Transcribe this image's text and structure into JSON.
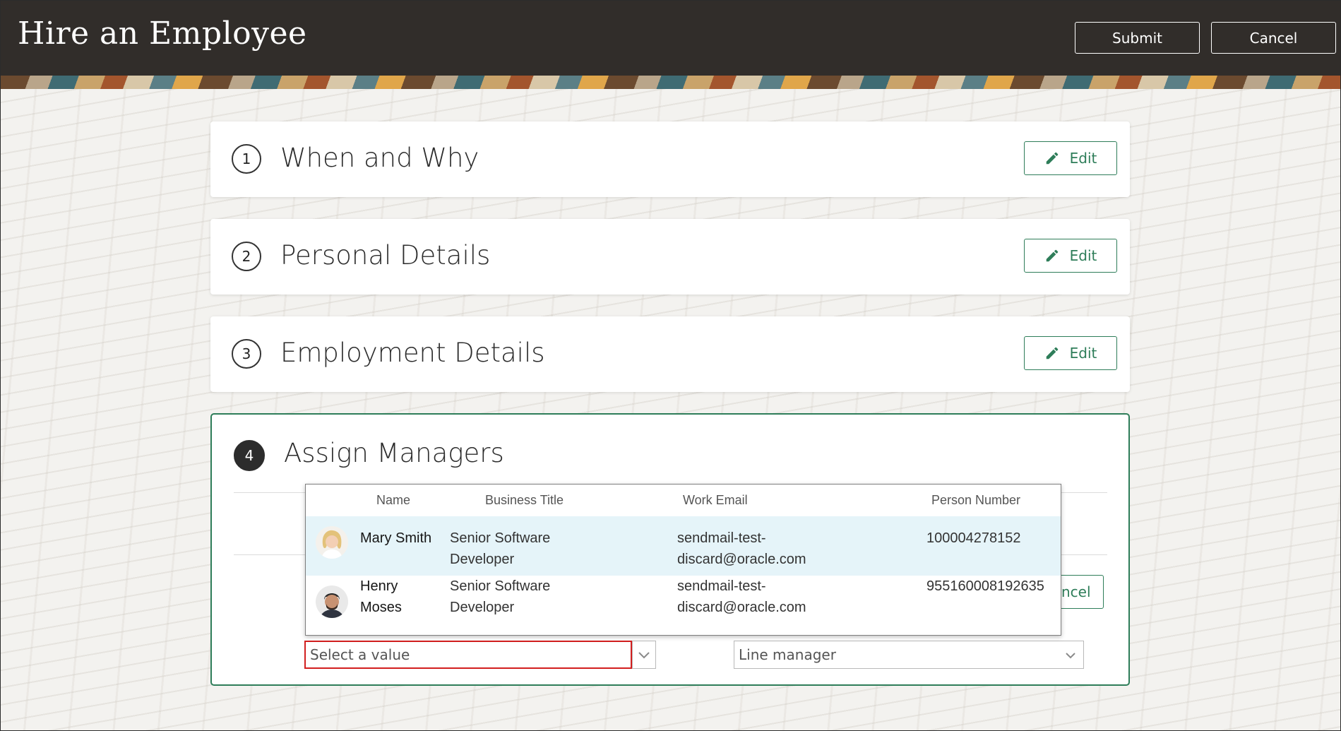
{
  "header": {
    "title": "Hire an Employee",
    "submit_label": "Submit",
    "cancel_label": "Cancel"
  },
  "steps": [
    {
      "number": "1",
      "title": "When and Why",
      "edit_label": "Edit"
    },
    {
      "number": "2",
      "title": "Personal Details",
      "edit_label": "Edit"
    },
    {
      "number": "3",
      "title": "Employment Details",
      "edit_label": "Edit"
    },
    {
      "number": "4",
      "title": "Assign Managers"
    }
  ],
  "assign_managers": {
    "partial_button_label": "ncel",
    "manager_select": {
      "placeholder": "Select a value"
    },
    "manager_type_select": {
      "value": "Line manager"
    }
  },
  "dropdown": {
    "columns": [
      "Name",
      "Business Title",
      "Work Email",
      "Person Number"
    ],
    "rows": [
      {
        "name_line1": "Mary Smith",
        "name_line2": "",
        "title_line1": "Senior Software",
        "title_line2": "Developer",
        "email_line1": "sendmail-test-",
        "email_line2": "discard@oracle.com",
        "person_number": "100004278152",
        "highlighted": true
      },
      {
        "name_line1": "Henry",
        "name_line2": "Moses",
        "title_line1": "Senior Software",
        "title_line2": "Developer",
        "email_line1": "sendmail-test-",
        "email_line2": "discard@oracle.com",
        "person_number": "955160008192635",
        "highlighted": false
      }
    ]
  },
  "colors": {
    "accent": "#2e7d59",
    "header_bg": "#312d2a",
    "error": "#d21f1f",
    "highlight_row": "#e5f4f9"
  }
}
